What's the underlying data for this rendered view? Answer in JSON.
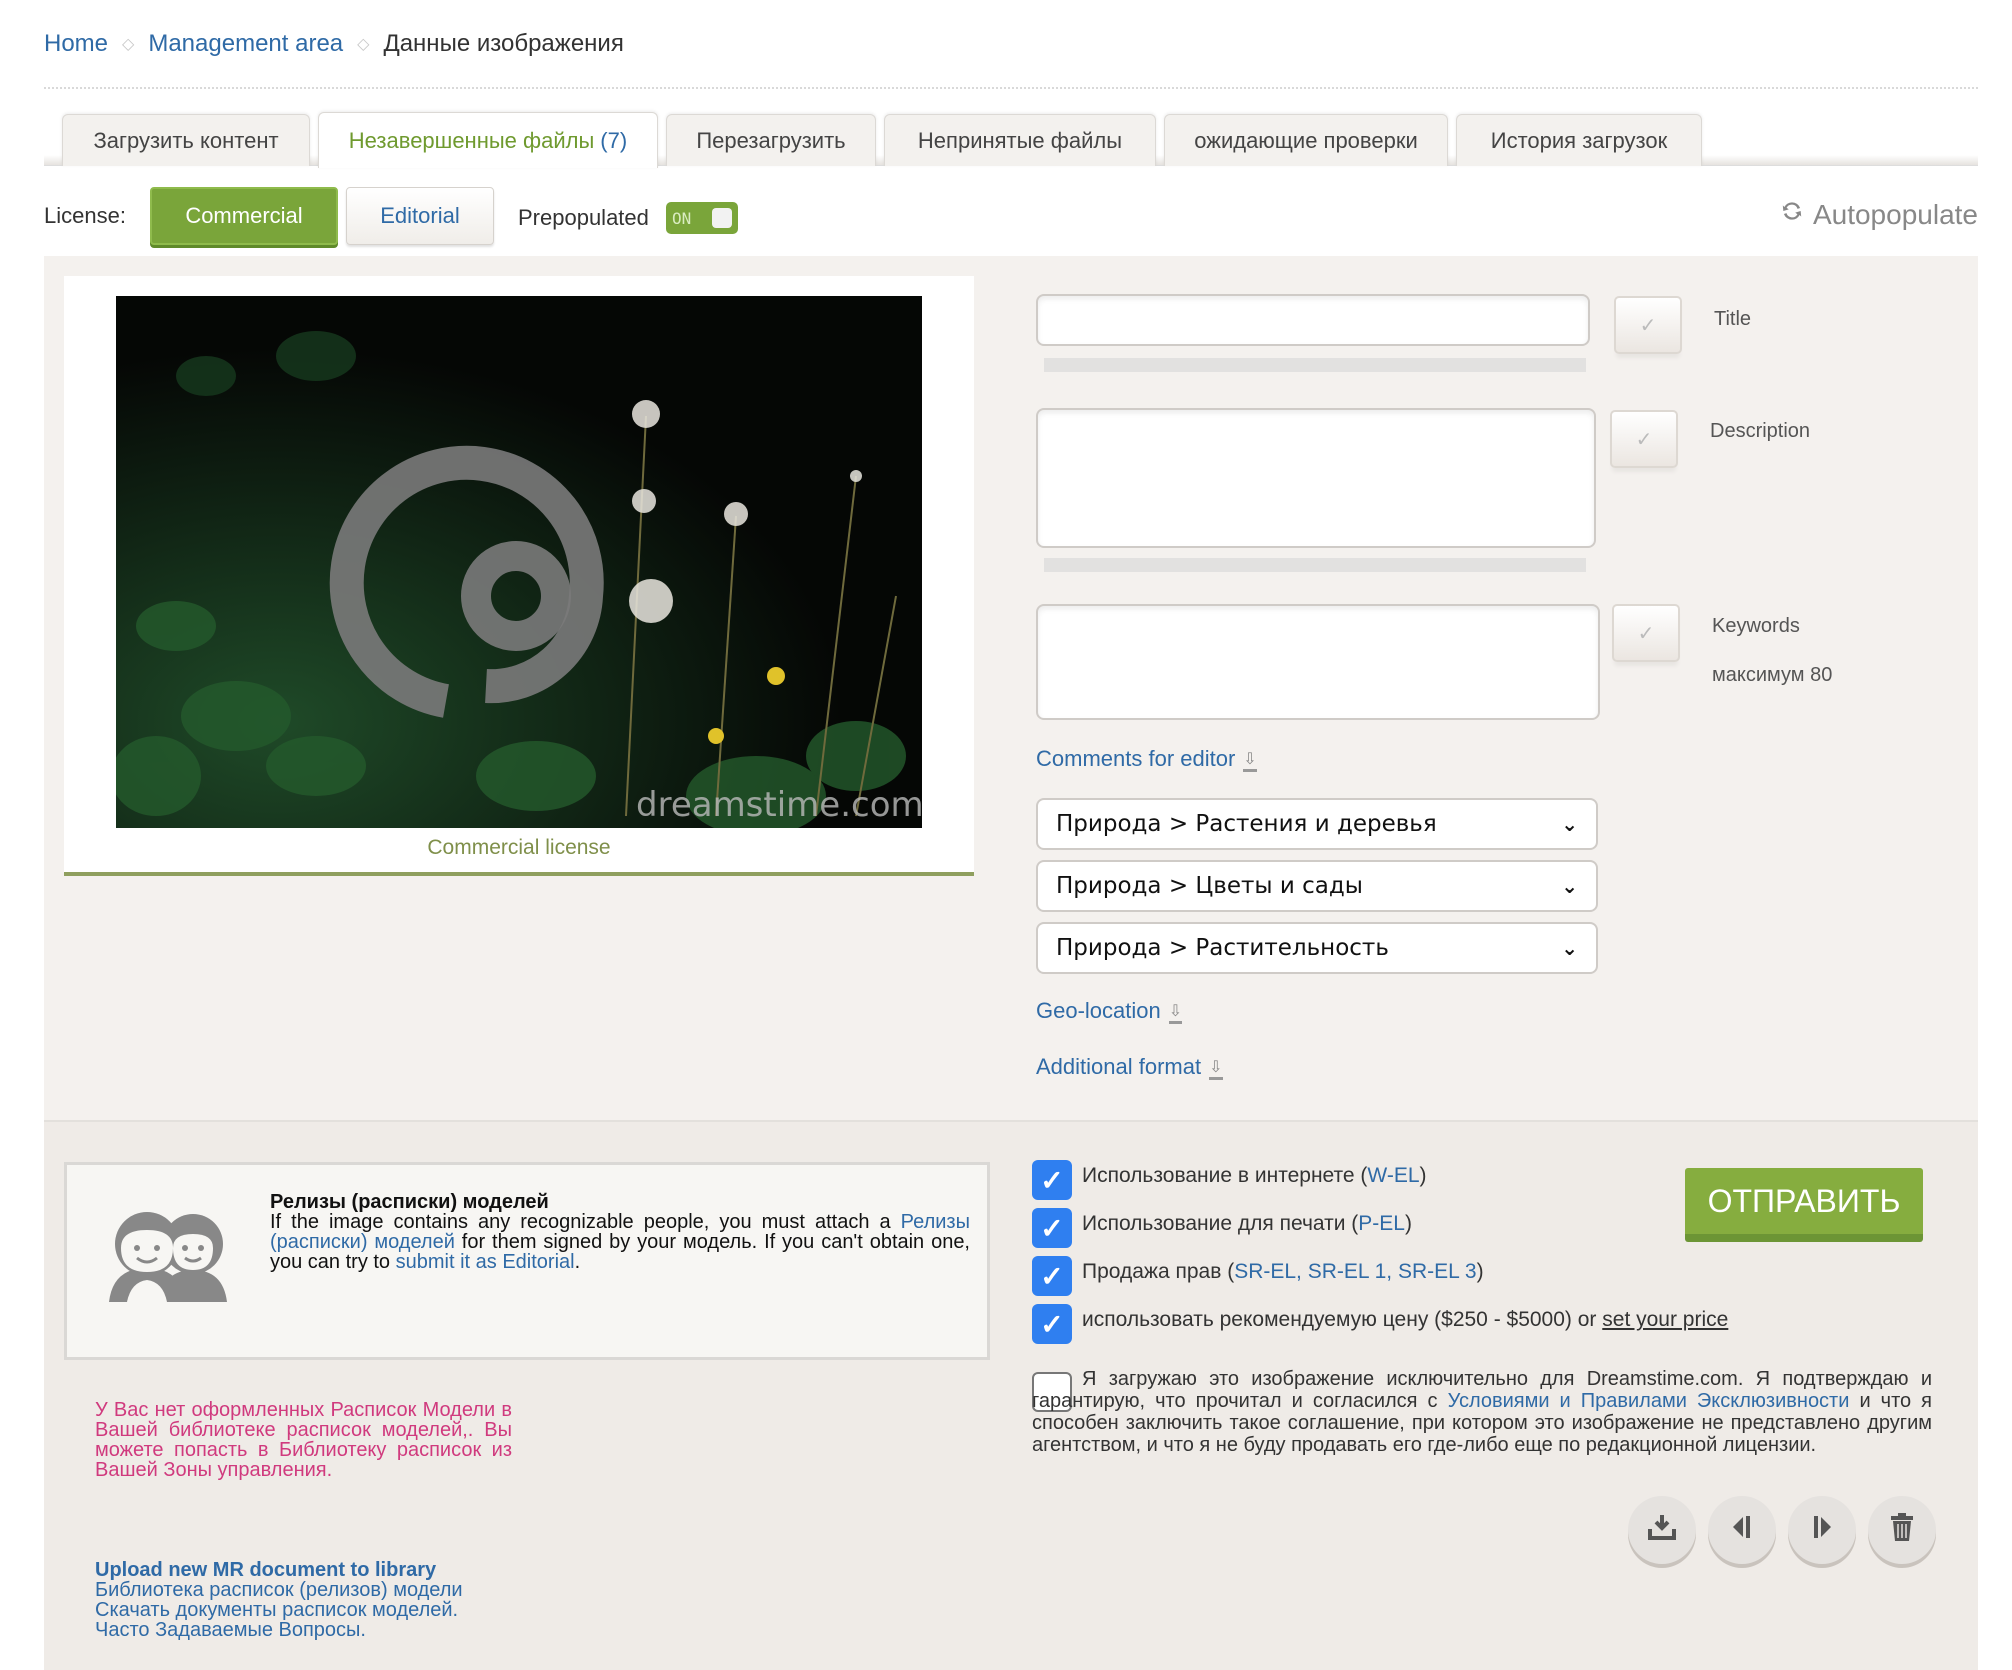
{
  "breadcrumb": {
    "home": "Home",
    "management": "Management area",
    "current": "Данные изображения",
    "separator": "◇"
  },
  "tabs": [
    {
      "label": "Загрузить контент",
      "active": false
    },
    {
      "label": "Незавершенные файлы",
      "count": "(7)",
      "active": true
    },
    {
      "label": "Перезагрузить",
      "active": false
    },
    {
      "label": "Непринятые файлы",
      "active": false
    },
    {
      "label": "ожидающие проверки",
      "active": false
    },
    {
      "label": "История загрузок",
      "active": false
    }
  ],
  "license": {
    "label": "License:",
    "commercial": "Commercial",
    "editorial": "Editorial",
    "selected": "Commercial",
    "prepopulated_label": "Prepopulated",
    "toggle_state": "ON",
    "autopopulate": "Autopopulate"
  },
  "image": {
    "caption": "Commercial license",
    "watermark": "dreamstime.com"
  },
  "fields": {
    "title": {
      "label": "Title",
      "value": ""
    },
    "description": {
      "label": "Description",
      "value": ""
    },
    "keywords": {
      "label": "Keywords",
      "value": "",
      "hint": "максимум 80"
    }
  },
  "links": {
    "comments": "Comments for editor",
    "geo": "Geo-location",
    "additional": "Additional format"
  },
  "categories": [
    "Природа > Растения и деревья",
    "Природа > Цветы и сады",
    "Природа > Растительность"
  ],
  "model_release": {
    "title": "Релизы (расписки) моделей",
    "text1": "If the image contains any recognizable people, you must attach a",
    "link1": "Релизы (расписки) моделей",
    "text2": "for them signed by your модель. If you can't obtain one, you can try to",
    "link2": "submit it as Editorial",
    "text3": ".",
    "warning": "У Вас нет оформленных Расписок Модели в Вашей библиотеке расписок моделей,. Вы можете попасть в Библиотеку расписок из Вашей Зоны управления.",
    "upload_link": "Upload new MR document to library",
    "library_link": "Библиотека расписок (релизов) модели",
    "download_link": "Скачать документы расписок моделей.",
    "faq_link": "Часто Задаваемые Вопросы."
  },
  "options": [
    {
      "label": "Использование в интернете (",
      "link": "W-EL",
      "suffix": ")",
      "checked": true
    },
    {
      "label": "Использование для печати (",
      "link": "P-EL",
      "suffix": ")",
      "checked": true
    },
    {
      "label": "Продажа прав (",
      "link": "SR-EL, SR-EL 1, SR-EL 3",
      "suffix": ")",
      "checked": true
    },
    {
      "label": "использовать рекомендуемую цену ($250 - $5000) or ",
      "link": "set your price",
      "suffix": "",
      "checked": true
    }
  ],
  "exclusive": {
    "checked": false,
    "text1": "Я загружаю это изображение исключительно для Dreamstime.com. Я подтверждаю и гарантирую, что прочитал и согласился с",
    "link": "Условиями и Правилами Эксклюзивности",
    "text2": "и что я способен заключить такое соглашение, при котором это изображение не представлено другим агентством, и что я не буду продавать его где-либо еще по редакционной лицензии."
  },
  "submit_label": "ОТПРАВИТЬ",
  "actions": [
    {
      "name": "upload-icon",
      "glyph": "⤓"
    },
    {
      "name": "previous-icon",
      "glyph": "◀"
    },
    {
      "name": "next-icon",
      "glyph": "▶"
    },
    {
      "name": "trash-icon",
      "glyph": "🗑"
    }
  ],
  "colors": {
    "accent_green": "#7aa53a",
    "link_blue": "#2f6aa6",
    "warning_pink": "#d03a7e",
    "checkbox_blue": "#2f7ff0"
  }
}
